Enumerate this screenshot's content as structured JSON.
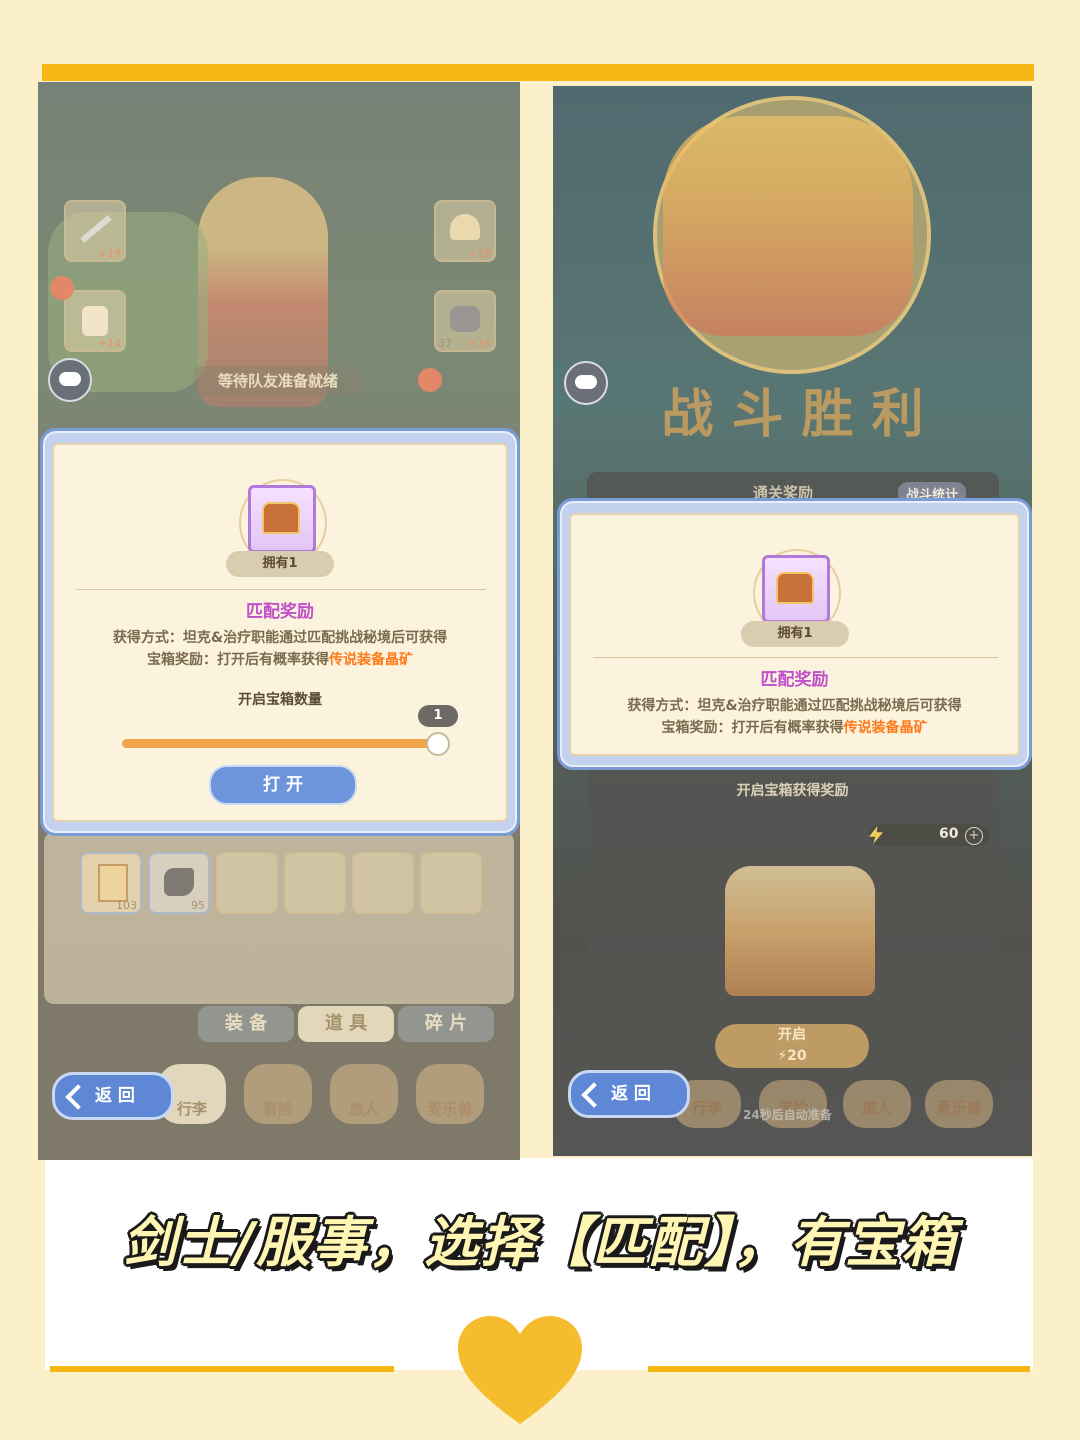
{
  "colors": {
    "accent_yellow": "#f7b712",
    "dialog_border": "#7b9bd6",
    "title_purple": "#c04fc9",
    "highlight_orange": "#ff7a1a",
    "slider_orange": "#f1a54a",
    "open_button": "#5e88d6"
  },
  "left": {
    "waiting_text": "等待队友准备就绪",
    "equip_badges": {
      "sword": "+19",
      "helmet": "+19",
      "armor": "+14",
      "boots": "+19",
      "boots_level": "37"
    },
    "dialog": {
      "owned": "拥有1",
      "title": "匹配奖励",
      "line1": "获得方式：坦克&治疗职能通过匹配挑战秘境后可获得",
      "line2_prefix": "宝箱奖励：打开后有概率获得",
      "line2_highlight": "传说装备晶矿",
      "quantity_label": "开启宝箱数量",
      "quantity_value": "1",
      "quantity_fraction": 1.0,
      "open_button": "打 开"
    },
    "inventory": [
      {
        "count": "103"
      },
      {
        "count": "95"
      }
    ],
    "tabs": [
      "装 备",
      "道 具",
      "碎 片"
    ],
    "nav": [
      "行李",
      "冒险",
      "旅人",
      "麦乐兽"
    ],
    "return_button": "返 回"
  },
  "right": {
    "victory_text": "战 斗 胜 利",
    "reward_tab": "通关奖励",
    "stats_tab": "战斗统计",
    "dialog": {
      "owned": "拥有1",
      "title": "匹配奖励",
      "line1": "获得方式：坦克&治疗职能通过匹配挑战秘境后可获得",
      "line2_prefix": "宝箱奖励：打开后有概率获得",
      "line2_highlight": "传说装备晶矿"
    },
    "chest_panel_title": "开启宝箱获得奖励",
    "energy_value": "60",
    "open_label": "开启",
    "open_cost": "20",
    "nav": [
      "行李",
      "冒险",
      "旅人",
      "麦乐兽"
    ],
    "bottom_hint": "24秒后自动准备",
    "return_button": "返 回"
  },
  "caption": "剑士/服事，选择【匹配】，有宝箱"
}
